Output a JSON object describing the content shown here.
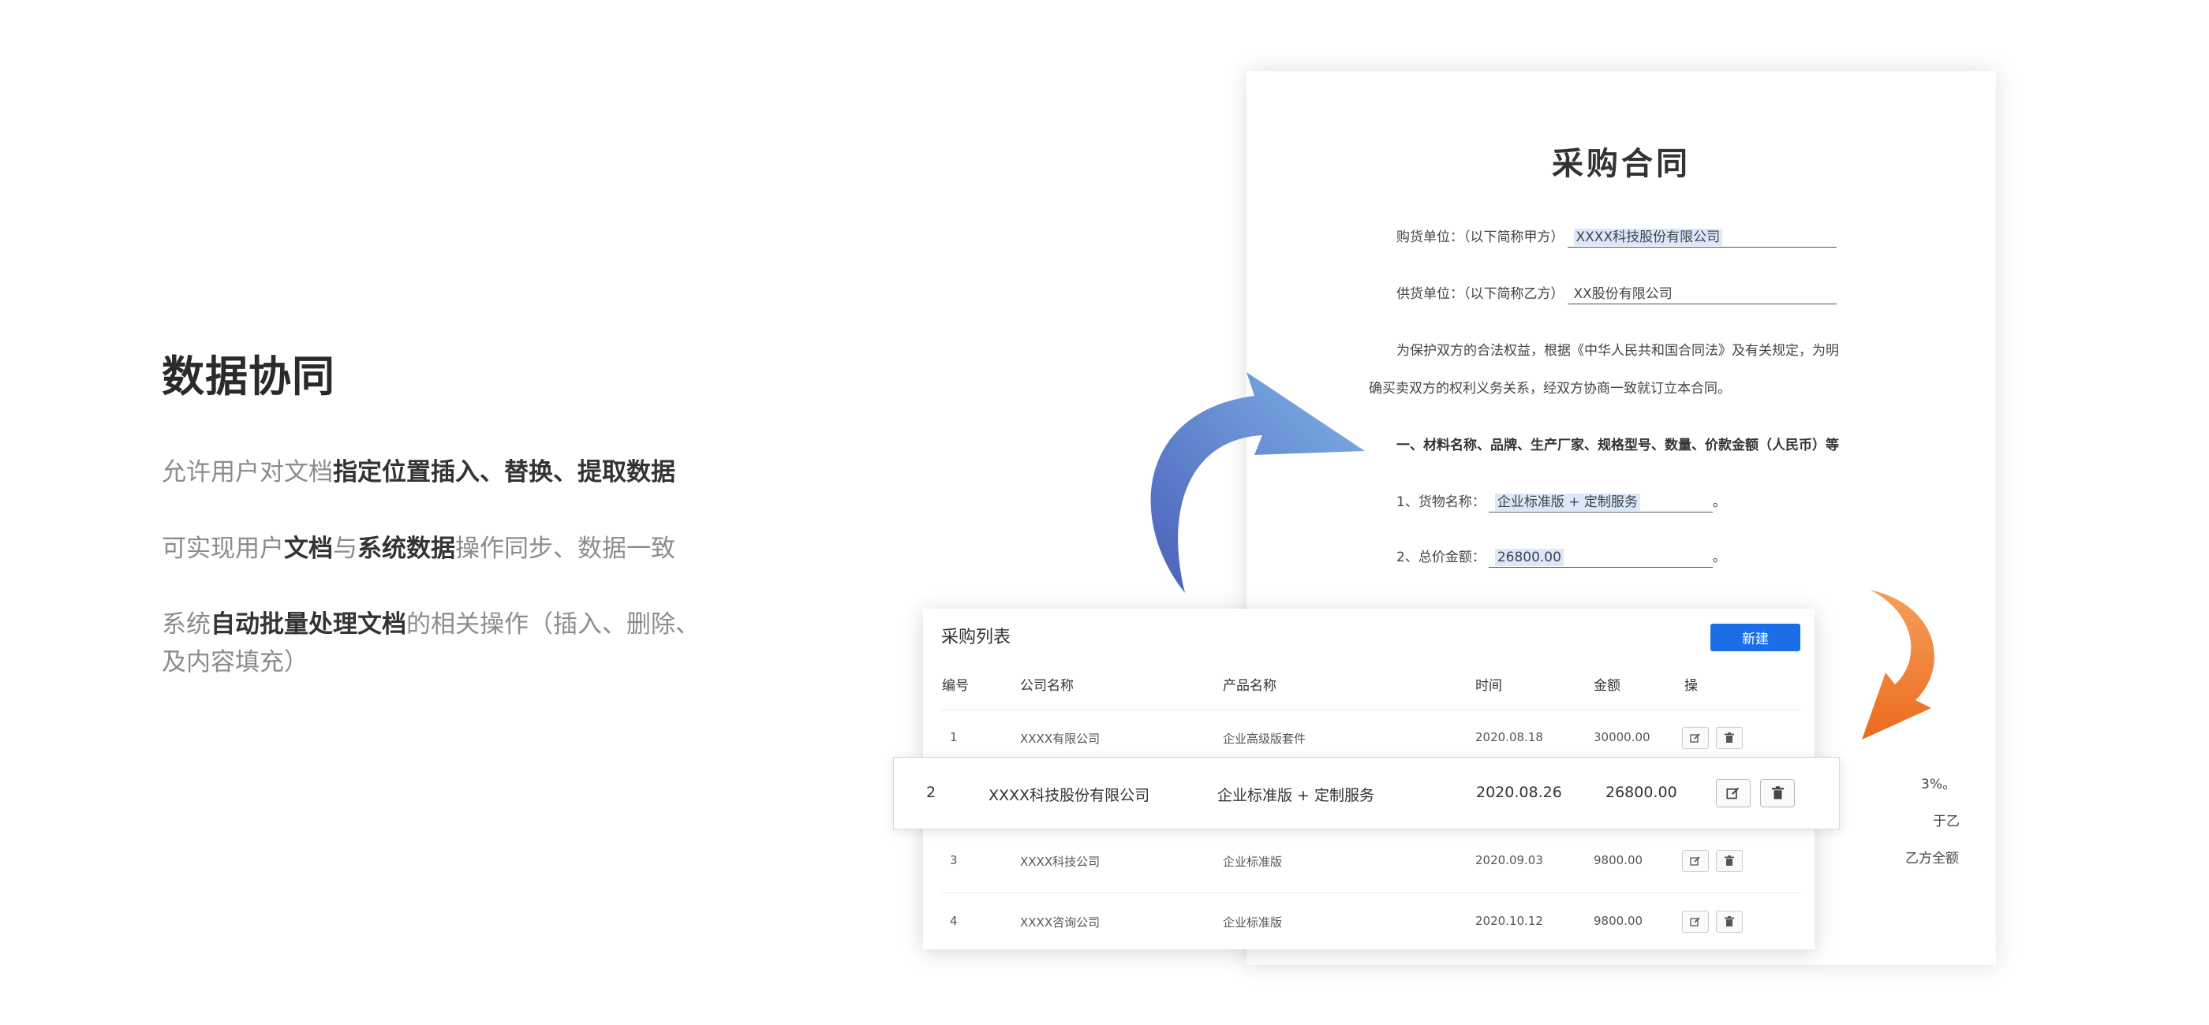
{
  "intro": {
    "title": "数据协同",
    "p1": {
      "a": "允许用户对文档",
      "b": "指定位置插入、替换、提取数据"
    },
    "p2": {
      "a": "可实现用户",
      "b": "文档",
      "c": "与",
      "d": "系统数据",
      "e": "操作同步、数据一致"
    },
    "p3": {
      "a": "系统",
      "b": "自动批量处理文档",
      "c": "的相关操作（插入、删除、及内容填充）"
    }
  },
  "contract": {
    "title": "采购合同",
    "buyer_label": "购货单位：（以下简称甲方）",
    "buyer_value": "XXXX科技股份有限公司",
    "supplier_label": "供货单位：（以下简称乙方）",
    "supplier_value": "XX股份有限公司",
    "para1_line1": "为保护双方的合法权益，根据《中华人民共和国合同法》及有关规定，为明",
    "para1_line2": "确买卖双方的权利义务关系，经双方协商一致就订立本合同。",
    "section1": "一、材料名称、品牌、生产厂家、规格型号、数量、价款金额（人民币）等",
    "item1_label": "1、货物名称：",
    "item1_value": "企业标准版 + 定制服务",
    "item2_label": "2、总价金额：",
    "item2_value": "26800.00",
    "end_mark": "。",
    "partial_3": "3%。",
    "partial_4": "于乙",
    "partial_5": "乙方全额"
  },
  "table": {
    "title": "采购列表",
    "new_button": "新建",
    "headers": {
      "no": "编号",
      "company": "公司名称",
      "product": "产品名称",
      "date": "时间",
      "amount": "金额",
      "ops": "操"
    },
    "rows": [
      {
        "no": "1",
        "company": "XXXX有限公司",
        "product": "企业高级版套件",
        "date": "2020.08.18",
        "amount": "30000.00"
      },
      {
        "no": "2",
        "company": "XXXX科技股份有限公司",
        "product": "企业标准版 + 定制服务",
        "date": "2020.08.26",
        "amount": "26800.00"
      },
      {
        "no": "3",
        "company": "XXXX科技公司",
        "product": "企业标准版",
        "date": "2020.09.03",
        "amount": "9800.00"
      },
      {
        "no": "4",
        "company": "XXXX咨询公司",
        "product": "企业标准版",
        "date": "2020.10.12",
        "amount": "9800.00"
      }
    ]
  },
  "icons": {
    "edit": "edit-icon",
    "delete": "trash-icon",
    "arrow_blue": "curved-arrow-blue",
    "arrow_orange": "curved-arrow-orange"
  },
  "colors": {
    "accent": "#1a6fe8",
    "highlight": "#dbe7fb",
    "arrow_blue_start": "#4a5fb8",
    "arrow_blue_end": "#7fb4e8",
    "arrow_orange": "#f07a2a"
  }
}
